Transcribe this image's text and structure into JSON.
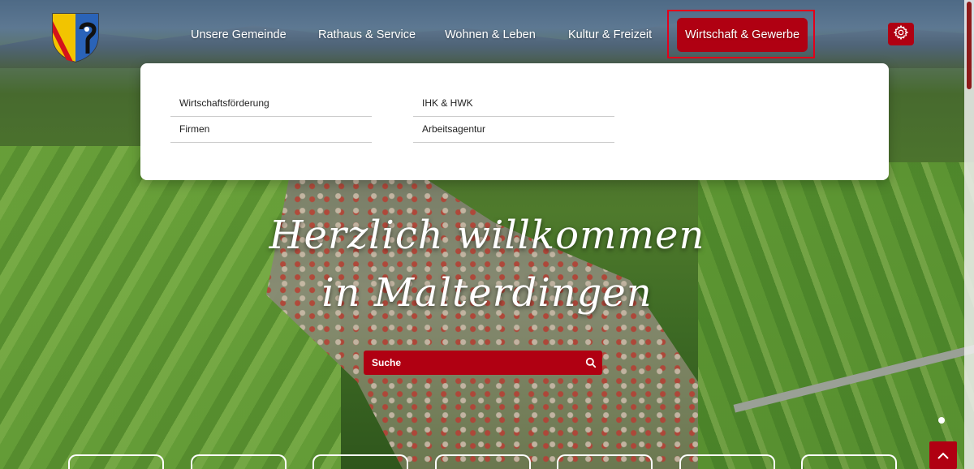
{
  "header": {
    "nav": [
      {
        "label": "Unsere Gemeinde"
      },
      {
        "label": "Rathaus & Service"
      },
      {
        "label": "Wohnen & Leben"
      },
      {
        "label": "Kultur & Freizeit"
      },
      {
        "label": "Wirtschaft & Gewerbe",
        "active": true
      }
    ]
  },
  "dropdown": {
    "col1": [
      "Wirtschaftsförderung",
      "Firmen"
    ],
    "col2": [
      "IHK & HWK",
      "Arbeitsagentur"
    ]
  },
  "hero": {
    "line1": "Herzlich willkommen",
    "line2": "in Malterdingen"
  },
  "search": {
    "placeholder": "Suche"
  },
  "colors": {
    "brand_red": "#b00012",
    "highlight_frame": "#e3001b"
  },
  "icons": {
    "settings": "gear-icon",
    "search": "search-icon",
    "back_to_top": "chevron-up-icon"
  }
}
